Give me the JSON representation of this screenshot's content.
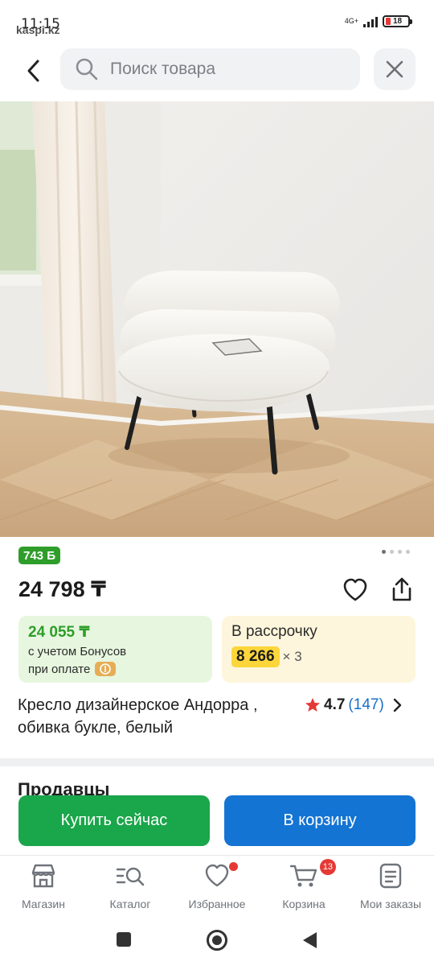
{
  "status": {
    "time": "11:15",
    "site": "kaspi.kz",
    "network": "4G+",
    "battery": "18"
  },
  "search": {
    "placeholder": "Поиск товара"
  },
  "product": {
    "bonus_badge": "743 Б",
    "price": "24 798 ₸",
    "bonus_price": "24 055 ₸",
    "bonus_line1": "с учетом Бонусов",
    "bonus_line2": "при оплате",
    "installment_title": "В рассрочку",
    "installment_amount": "8 266",
    "installment_mult": "× 3",
    "title": "Кресло дизайнерское Андорра , обивка букле, белый",
    "rating": "4.7",
    "reviews": "(147)"
  },
  "sellers": {
    "heading": "Продавцы"
  },
  "actions": {
    "buy_now": "Купить сейчас",
    "add_to_cart": "В корзину"
  },
  "tabs": [
    {
      "label": "Магазин",
      "icon": "store-icon"
    },
    {
      "label": "Каталог",
      "icon": "catalog-search-icon"
    },
    {
      "label": "Избранное",
      "icon": "heart-icon"
    },
    {
      "label": "Корзина",
      "icon": "cart-icon",
      "badge": "13"
    },
    {
      "label": "Мои заказы",
      "icon": "orders-icon"
    }
  ],
  "colors": {
    "green": "#1aa64a",
    "blue": "#1474d3",
    "bonus_green": "#2e9d2a",
    "installment_yellow": "#fcd63a",
    "badge_red": "#e53935"
  }
}
